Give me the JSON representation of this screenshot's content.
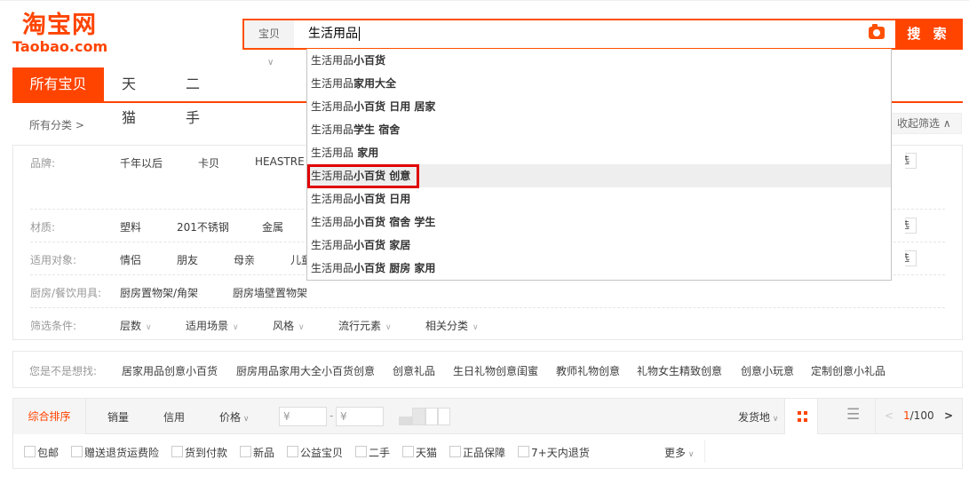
{
  "logo": {
    "cn": "淘宝网",
    "en": "Taobao.com"
  },
  "search": {
    "category": "宝贝",
    "query": "生活用品",
    "button": "搜 索",
    "camera_icon": "camera-icon"
  },
  "suggestions": [
    {
      "prefix": "生活用品",
      "suffix": "小百货"
    },
    {
      "prefix": "生活用品",
      "suffix": "家用大全"
    },
    {
      "prefix": "生活用品",
      "suffix": "小百货 日用 居家"
    },
    {
      "prefix": "生活用品",
      "suffix": "学生 宿舍"
    },
    {
      "prefix": "生活用品",
      "suffix": " 家用"
    },
    {
      "prefix": "生活用品",
      "suffix": "小百货 创意"
    },
    {
      "prefix": "生活用品",
      "suffix": "小百货 日用"
    },
    {
      "prefix": "生活用品",
      "suffix": "小百货 宿舍 学生"
    },
    {
      "prefix": "生活用品",
      "suffix": "小百货 家居"
    },
    {
      "prefix": "生活用品",
      "suffix": "小百货 厨房 家用"
    }
  ],
  "tabs": [
    "所有宝贝",
    "天猫",
    "二手"
  ],
  "breadcrumb": "所有分类 >",
  "collapse": "收起筛选 ∧",
  "filters": {
    "brand": {
      "label": "品牌:",
      "values": [
        "千年以后",
        "卡贝",
        "HEASTRE"
      ]
    },
    "material": {
      "label": "材质:",
      "values": [
        "塑料",
        "201不锈钢",
        "金属"
      ]
    },
    "target": {
      "label": "适用对象:",
      "values": [
        "情侣",
        "朋友",
        "母亲",
        "儿童"
      ]
    },
    "kitchen": {
      "label": "厨房/餐饮用具:",
      "values": [
        "厨房置物架/角架",
        "厨房墙壁置物架"
      ]
    },
    "conditions": {
      "label": "筛选条件:",
      "values": [
        "层数",
        "适用场景",
        "风格",
        "流行元素",
        "相关分类"
      ]
    },
    "multi": "选"
  },
  "did_you_mean": {
    "label": "您是不是想找:",
    "items": [
      "居家用品创意小百货",
      "厨房用品家用大全小百货创意",
      "创意礼品",
      "生日礼物创意闺蜜",
      "教师礼物创意",
      "礼物女生精致创意",
      "创意小玩意",
      "定制创意小礼品"
    ]
  },
  "sort": {
    "items": [
      "综合排序",
      "销量",
      "信用",
      "价格"
    ],
    "price_from": "¥",
    "price_to": "¥",
    "dash": "-",
    "ship_from": "发货地",
    "page_current": "1",
    "page_total": "/100",
    "prev": "<",
    "next": ">"
  },
  "checkboxes": [
    "包邮",
    "赠送退货运费险",
    "货到付款",
    "新品",
    "公益宝贝",
    "二手",
    "天猫",
    "正品保障",
    "7+天内退货"
  ],
  "more": "更多",
  "colors": {
    "accent": "#ff4400",
    "highlight": "#e00000"
  }
}
